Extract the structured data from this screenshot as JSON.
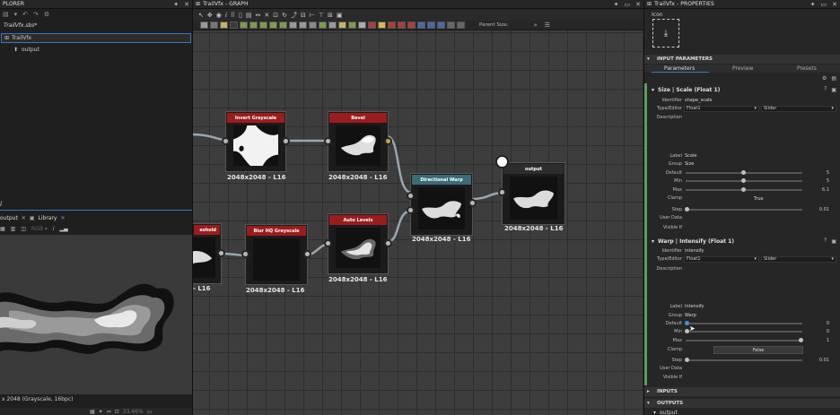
{
  "explorer": {
    "title": "PLORER",
    "file": "TrailVfx.sbs*",
    "graph_item": "TrailVfx",
    "output_item": "output",
    "tabs": [
      "output",
      "Library"
    ],
    "preview_status": "x 2048 (Grayscale, 16bpc)",
    "zoom": "33.46%",
    "info_tab": "i"
  },
  "graph": {
    "title": "TrailVfx - GRAPH",
    "parent_size_label": "Parent Size:",
    "nodes": [
      {
        "id": "invert",
        "label": "Invert Grayscale",
        "size": "2048x2048 - L16"
      },
      {
        "id": "bevel",
        "label": "Bevel",
        "size": "2048x2048 - L16"
      },
      {
        "id": "dirwarp",
        "label": "Directional Warp",
        "size": "2048x2048 - L16"
      },
      {
        "id": "output",
        "label": "output",
        "size": "2048x2048 - L16"
      },
      {
        "id": "blur",
        "label": "Blur HQ Greyscale",
        "size": "2048x2048 - L16"
      },
      {
        "id": "autolevels",
        "label": "Auto Levels",
        "size": "2048x2048 - L16"
      },
      {
        "id": "left1",
        "label": "eshold",
        "size": ""
      },
      {
        "id": "left2",
        "label": "",
        "size": "- L16"
      }
    ],
    "colors": {
      "red_header": "#9b1c1c",
      "blue_header": "#3b6a78",
      "dark_header": "#2d2d2d"
    }
  },
  "props": {
    "title": "TrailVfx - PROPERTIES",
    "icon_label": "Icon",
    "section_input_params": "INPUT PARAMETERS",
    "tabs": [
      "Parameters",
      "Preview",
      "Presets"
    ],
    "param1": {
      "header": "Size | Scale (Float 1)",
      "identifier_label": "Identifier",
      "identifier": "shape_scale",
      "type_label": "Type/Editor",
      "type": "Float1",
      "editor": "Slider",
      "description_label": "Description",
      "label_label": "Label",
      "label": "Scale",
      "group_label": "Group",
      "group": "Size",
      "default_label": "Default",
      "default": "5",
      "min_label": "Min",
      "min": "5",
      "max_label": "Max",
      "max": "6.1",
      "clamp_label": "Clamp",
      "clamp": "True",
      "step_label": "Step",
      "step": "0.01",
      "userdata_label": "User Data",
      "visibleif_label": "Visible If"
    },
    "param2": {
      "header": "Warp | Intensify (Float 1)",
      "identifier_label": "Identifier",
      "identifier": "intensify",
      "type_label": "Type/Editor",
      "type": "Float1",
      "editor": "Slider",
      "description_label": "Description",
      "label_label": "Label",
      "label": "Intensify",
      "group_label": "Group",
      "group": "Warp",
      "default_label": "Default",
      "default": "0",
      "min_label": "Min",
      "min": "0",
      "max_label": "Max",
      "max": "1",
      "clamp_label": "Clamp",
      "clamp": "False",
      "step_label": "Step",
      "step": "0.01",
      "userdata_label": "User Data",
      "visibleif_label": "Visible If"
    },
    "section_inputs": "INPUTS",
    "section_outputs": "OUTPUTS",
    "output_item": "output"
  }
}
